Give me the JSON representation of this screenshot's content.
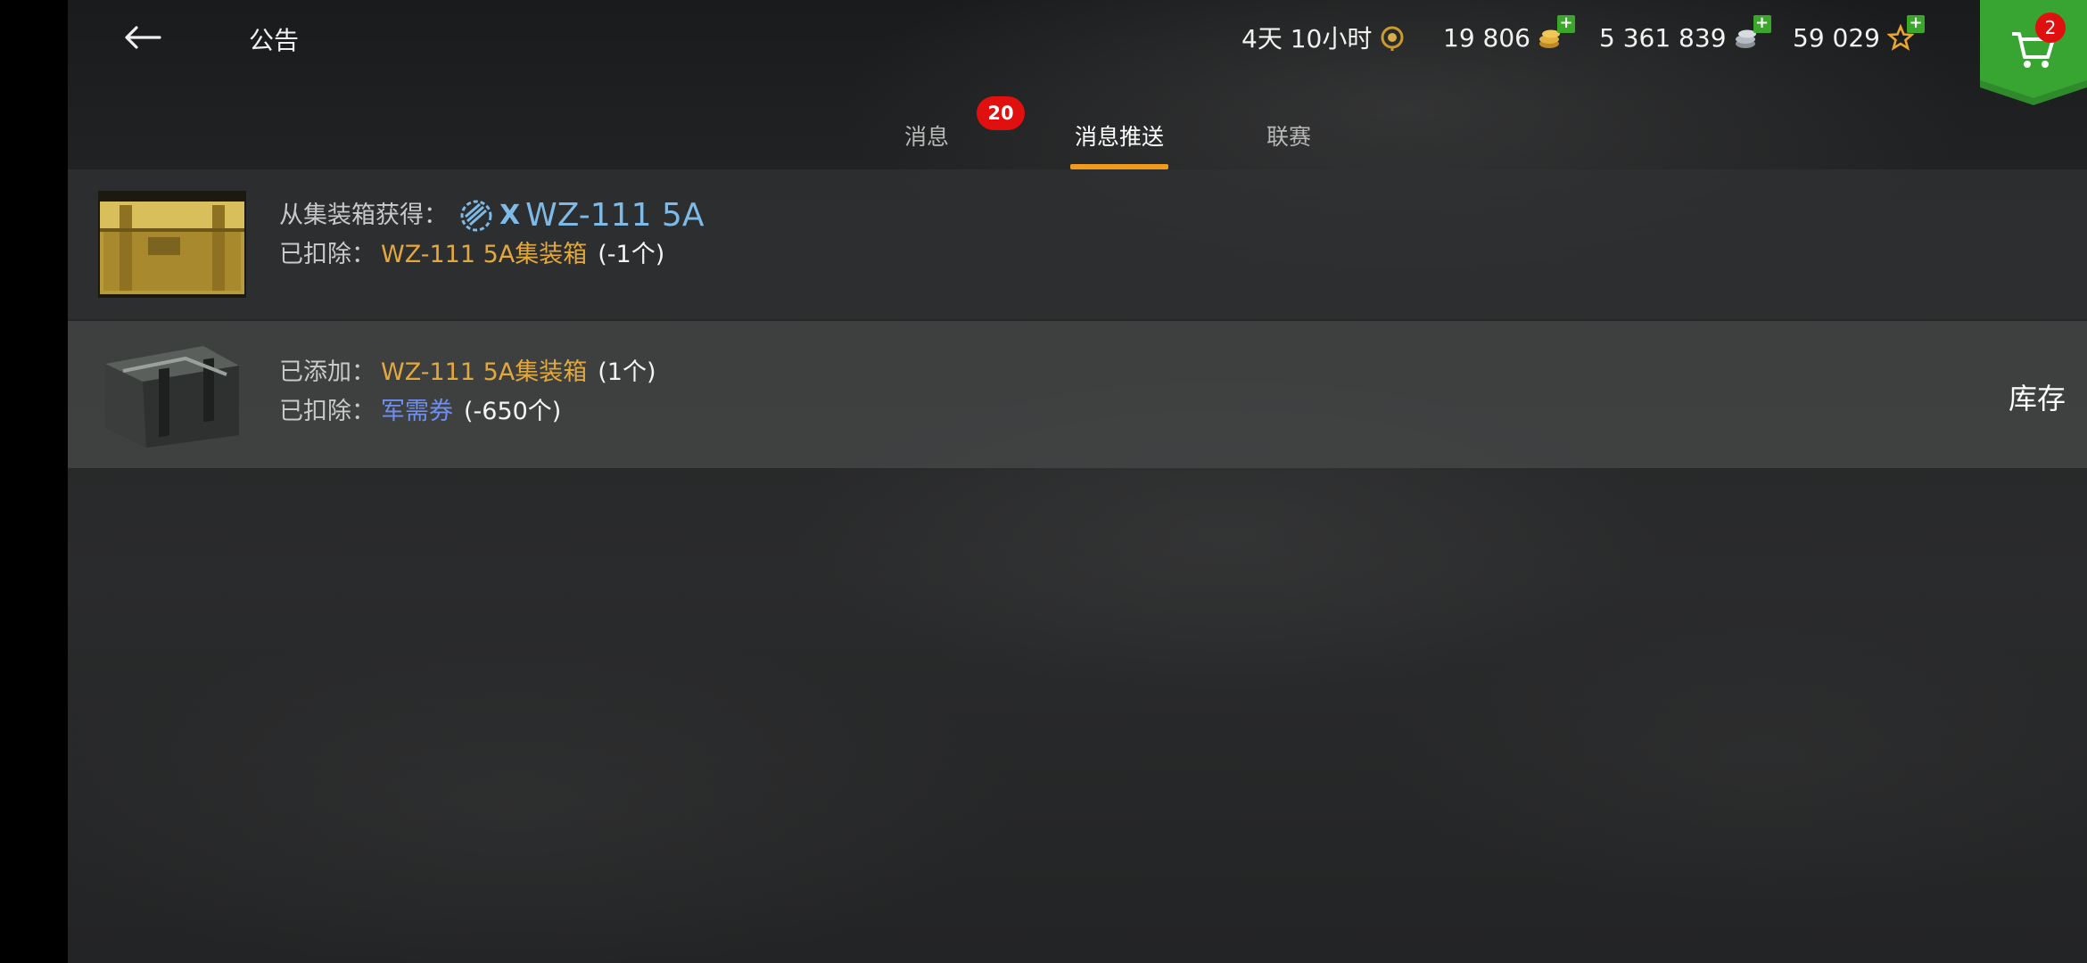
{
  "header": {
    "title": "公告",
    "stats": [
      {
        "value": "4天 10小时",
        "icon": "premium-laurel-icon"
      },
      {
        "value": "19 806",
        "icon": "gold-coins-icon"
      },
      {
        "value": "5 361 839",
        "icon": "silver-credits-icon"
      },
      {
        "value": "59 029",
        "icon": "free-xp-star-icon"
      }
    ],
    "cart_count": "2"
  },
  "tabs": [
    {
      "label": "消息",
      "badge": "20"
    },
    {
      "label": "消息推送",
      "active": true
    },
    {
      "label": "联赛"
    }
  ],
  "messages": [
    {
      "line1_label": "从集装箱获得：",
      "tier": "X",
      "tank": "WZ-111 5A",
      "line2_label": "已扣除：",
      "line2_item": "WZ-111 5A集装箱",
      "line2_qty": "(-1个)"
    },
    {
      "line1_label": "已添加：",
      "line1_item": "WZ-111 5A集装箱",
      "line1_qty": "(1个)",
      "line2_label": "已扣除：",
      "line2_item": "军需券",
      "line2_qty": "(-650个)",
      "action": "库存"
    }
  ],
  "colors": {
    "accent": "#f29a1d",
    "badge": "#e01010",
    "item_gold": "#e3a83c",
    "item_blue": "#6f8ff0",
    "tank_blue": "#7fb9e6"
  }
}
